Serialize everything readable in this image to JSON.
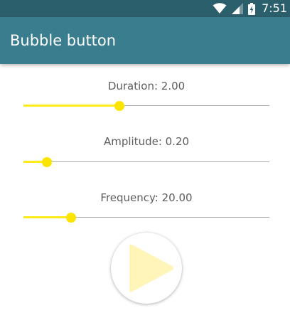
{
  "status_bar": {
    "time": "7:51",
    "icons": [
      "wifi-icon",
      "cell-signal-icon",
      "battery-charging-icon"
    ]
  },
  "app_bar": {
    "title": "Bubble button",
    "color": "#3a7d8f"
  },
  "controls": [
    {
      "label": "Duration: 2.00",
      "fraction": 0.39
    },
    {
      "label": "Amplitude: 0.20",
      "fraction": 0.095
    },
    {
      "label": "Frequency: 20.00",
      "fraction": 0.195
    }
  ],
  "accent_color": "#ffeb1a",
  "play_button": {
    "icon": "play-icon",
    "icon_color": "#fff5b8"
  }
}
